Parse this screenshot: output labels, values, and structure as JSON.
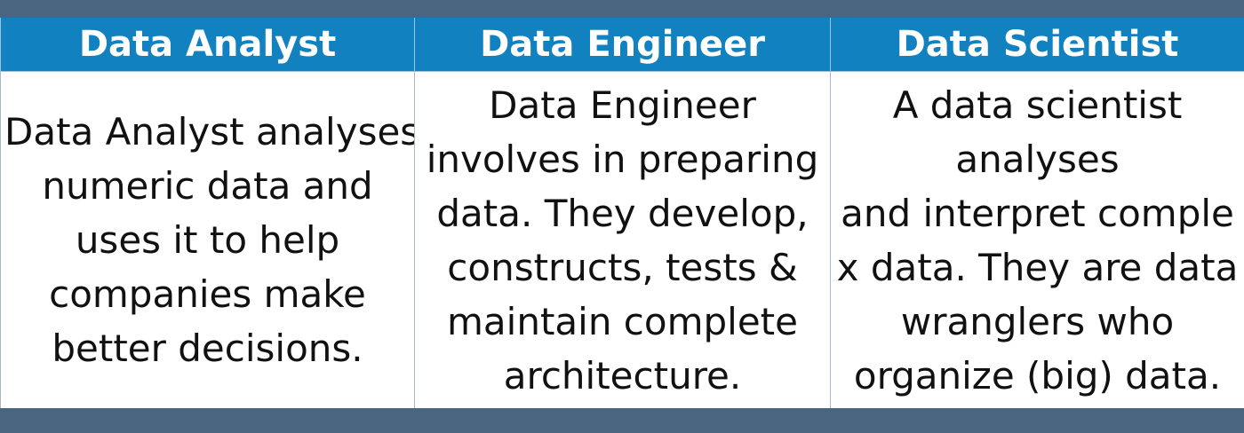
{
  "table": {
    "headers": [
      "Data Analyst",
      "Data Engineer",
      "Data Scientist"
    ],
    "cells": [
      [
        "Data Analyst analyses",
        "numeric data and",
        "uses it to help",
        "companies make",
        "better decisions."
      ],
      [
        "Data Engineer",
        "involves in preparing",
        "data. They develop,",
        "constructs, tests &",
        "maintain complete",
        "architecture."
      ],
      [
        "A data scientist",
        "analyses",
        "and interpret comple",
        "x data. They are data",
        "wranglers who",
        "organize (big) data."
      ]
    ]
  },
  "colors": {
    "header_bg": "#1181c0",
    "header_text": "#ffffff",
    "cell_bg": "#ffffff",
    "cell_text": "#111111",
    "page_bg": "#4a6580"
  }
}
